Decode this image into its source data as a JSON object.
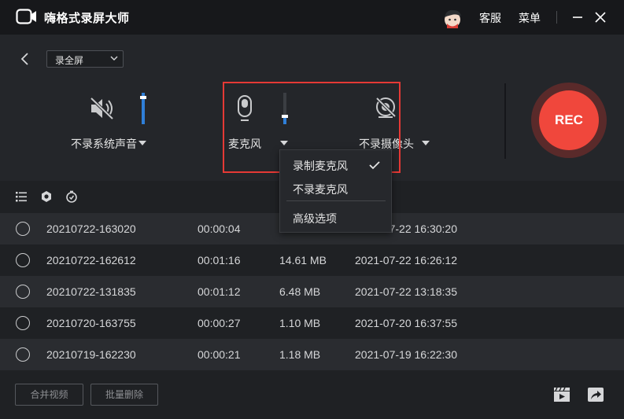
{
  "app": {
    "title": "嗨格式录屏大师",
    "logo_icon": "camera-logo-icon",
    "accent": "#f0473c"
  },
  "titlebar": {
    "service_label": "客服",
    "menu_label": "菜单",
    "minimize_icon": "minimize-icon",
    "close_icon": "close-icon",
    "avatar_icon": "user-avatar-icon"
  },
  "mode": {
    "selected": "录全屏"
  },
  "controls": {
    "system_audio": {
      "label": "不录系统声音",
      "icon": "speaker-muted-icon",
      "volume_level": 1.0
    },
    "microphone": {
      "label": "麦克风",
      "icon": "microphone-icon",
      "volume_level": 0.25
    },
    "camera": {
      "label": "不录摄像头",
      "icon": "camera-off-icon"
    }
  },
  "rec_button": {
    "label": "REC"
  },
  "mic_menu": {
    "items": [
      {
        "label": "录制麦克风",
        "checked": true
      },
      {
        "label": "不录麦克风",
        "checked": false
      },
      {
        "label": "高级选项",
        "checked": false
      }
    ]
  },
  "list_tools": {
    "icons": [
      "list-icon",
      "settings-hex-icon",
      "timer-icon"
    ]
  },
  "files": [
    {
      "name": "20210722-163020",
      "duration": "00:00:04",
      "size": "",
      "date": "2021-07-22 16:30:20"
    },
    {
      "name": "20210722-162612",
      "duration": "00:01:16",
      "size": "14.61 MB",
      "date": "2021-07-22 16:26:12"
    },
    {
      "name": "20210722-131835",
      "duration": "00:01:12",
      "size": "6.48 MB",
      "date": "2021-07-22 13:18:35"
    },
    {
      "name": "20210720-163755",
      "duration": "00:00:27",
      "size": "1.10 MB",
      "date": "2021-07-20 16:37:55"
    },
    {
      "name": "20210719-162230",
      "duration": "00:00:21",
      "size": "1.18 MB",
      "date": "2021-07-19 16:22:30"
    }
  ],
  "bottom": {
    "merge_label": "合并视频",
    "batch_delete_label": "批量删除",
    "editor_icon": "video-clapper-icon",
    "share_icon": "share-arrow-icon"
  }
}
